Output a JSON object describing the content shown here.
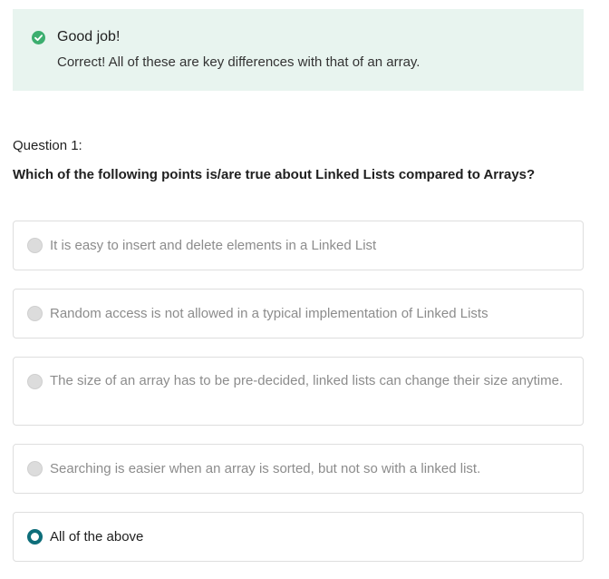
{
  "feedback": {
    "title": "Good job!",
    "message": "Correct! All of these are key differences with that of an array.",
    "icon": "check-circle-icon",
    "color": "#3cae6f"
  },
  "question": {
    "label": "Question 1:",
    "text": "Which of the following points is/are true about Linked Lists compared to Arrays?"
  },
  "options": [
    {
      "label": "It is easy to insert and delete elements in a Linked List",
      "selected": false
    },
    {
      "label": "Random access is not allowed in a typical implementation of Linked Lists",
      "selected": false
    },
    {
      "label": "The size of an array has to be pre-decided, linked lists can change their size anytime.",
      "selected": false
    },
    {
      "label": "Searching is easier when an array is sorted, but not so with a linked list.",
      "selected": false
    },
    {
      "label": "All of the above",
      "selected": true
    }
  ],
  "accent_color": "#0e6e7a"
}
